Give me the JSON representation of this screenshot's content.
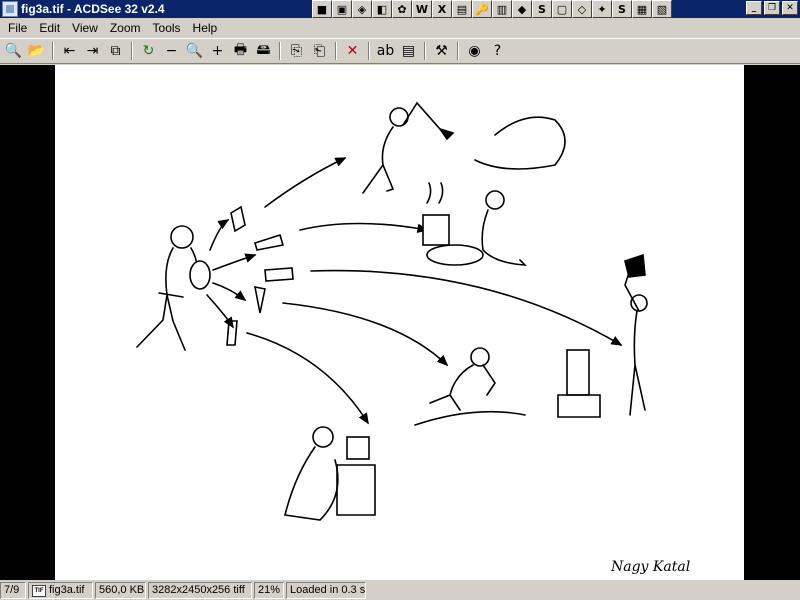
{
  "window": {
    "title": "fig3a.tif - ACDSee 32 v2.4"
  },
  "taskbar_icons": [
    "■",
    "▣",
    "◈",
    "◧",
    "✿",
    "W",
    "X",
    "▤",
    "🔑",
    "▥",
    "◆",
    "S",
    "▢",
    "◇",
    "✦",
    "S",
    "▦",
    "▧"
  ],
  "window_controls": {
    "minimize": "_",
    "restore": "❐",
    "close": "✕"
  },
  "menu": {
    "items": [
      "File",
      "Edit",
      "View",
      "Zoom",
      "Tools",
      "Help"
    ]
  },
  "toolbar": {
    "groups": [
      [
        "🔍",
        "📂"
      ],
      [
        "⇤",
        "⇥",
        "⧉"
      ],
      [
        "↻",
        "−",
        "🔍",
        "+",
        "🖶",
        "🖴"
      ],
      [
        "⎘",
        "⎗"
      ],
      [
        "✕"
      ],
      [
        "ab",
        "▤"
      ],
      [
        "⚒"
      ],
      [
        "◉",
        "?"
      ]
    ]
  },
  "image": {
    "signature": "Nagy Katal"
  },
  "status": {
    "index": "7/9",
    "file_type": "TIF",
    "filename": "fig3a.tif",
    "size": "560,0 KB",
    "dimensions": "3282x2450x256 tiff",
    "zoom": "21%",
    "load_time": "Loaded in 0.3 s"
  },
  "colors": {
    "title_bar": "#0a246a",
    "chrome": "#d4d0c8",
    "viewer_bg": "#000000"
  }
}
